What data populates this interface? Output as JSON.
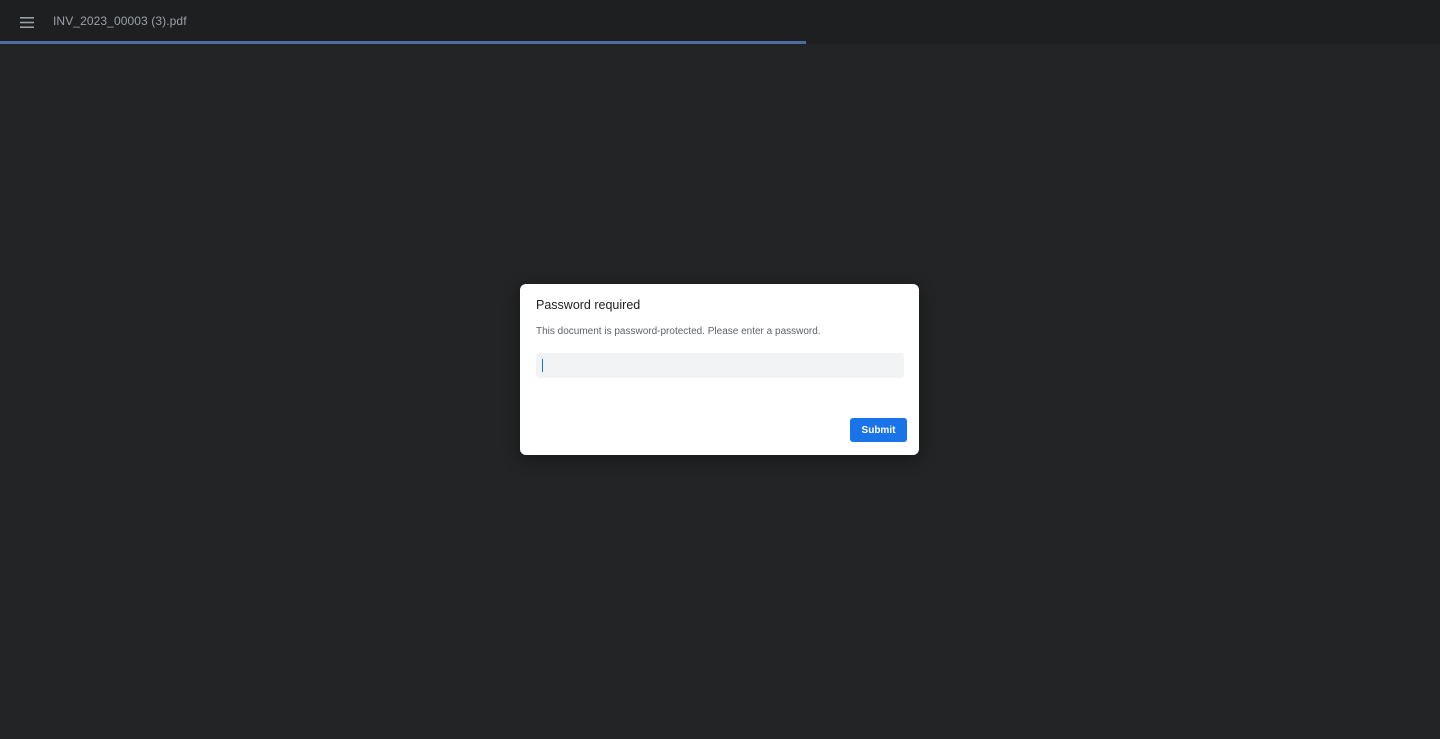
{
  "toolbar": {
    "menu_icon": "hamburger-menu-icon",
    "title": "INV_2023_00003 (3).pdf",
    "load_progress": 0.56,
    "progress_color": "#4e6ea3"
  },
  "dialog": {
    "title": "Password required",
    "message": "This document is password-protected. Please enter a password.",
    "password_value": "",
    "password_placeholder": "",
    "submit_label": "Submit",
    "accent_color": "#1a73e8"
  }
}
